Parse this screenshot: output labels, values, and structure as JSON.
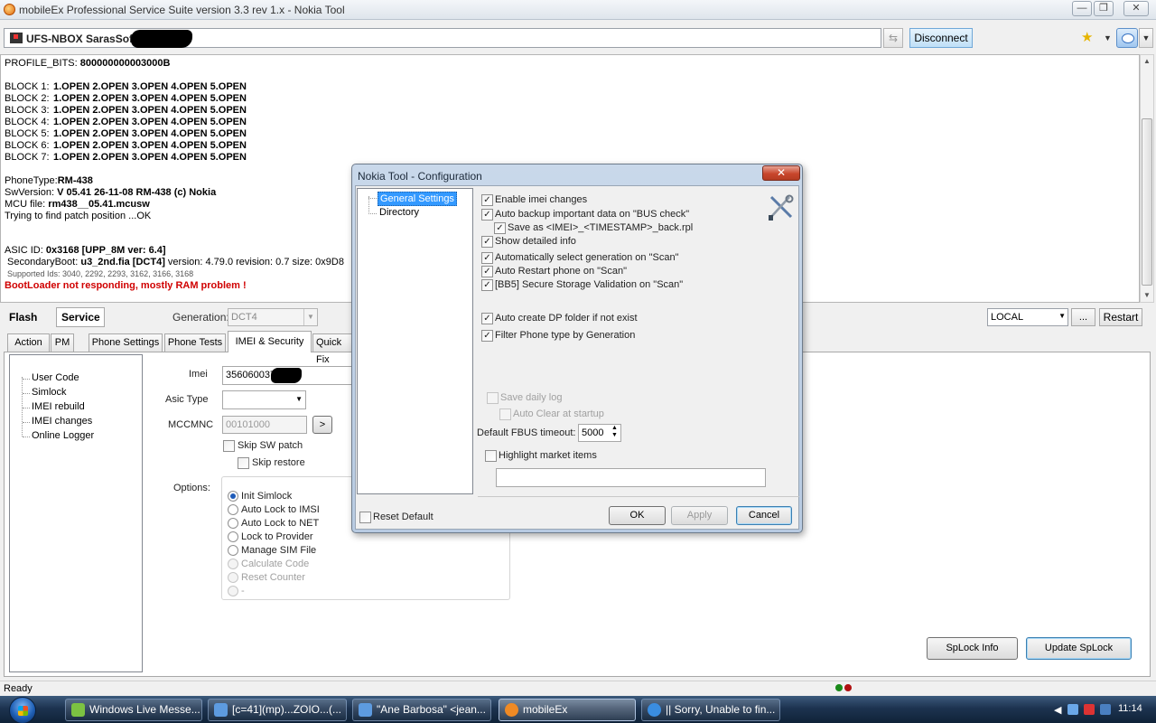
{
  "window": {
    "title": "mobileEx Professional Service Suite version 3.3 rev 1.x - Nokia Tool",
    "minimize": "—",
    "maximize": "❐",
    "close": "✕"
  },
  "toolbar": {
    "device": "UFS-NBOX SarasSoft -",
    "refresh": "⇆",
    "disconnect": "Disconnect"
  },
  "log": {
    "profile_label": "PROFILE_BITS:",
    "profile_value": "800000000003000B",
    "blocks": [
      {
        "label": "BLOCK 1:",
        "value": "1.OPEN 2.OPEN 3.OPEN 4.OPEN 5.OPEN"
      },
      {
        "label": "BLOCK 2:",
        "value": "1.OPEN 2.OPEN 3.OPEN 4.OPEN 5.OPEN"
      },
      {
        "label": "BLOCK 3:",
        "value": "1.OPEN 2.OPEN 3.OPEN 4.OPEN 5.OPEN"
      },
      {
        "label": "BLOCK 4:",
        "value": "1.OPEN 2.OPEN 3.OPEN 4.OPEN 5.OPEN"
      },
      {
        "label": "BLOCK 5:",
        "value": "1.OPEN 2.OPEN 3.OPEN 4.OPEN 5.OPEN"
      },
      {
        "label": "BLOCK 6:",
        "value": "1.OPEN 2.OPEN 3.OPEN 4.OPEN 5.OPEN"
      },
      {
        "label": "BLOCK 7:",
        "value": "1.OPEN 2.OPEN 3.OPEN 4.OPEN 5.OPEN"
      }
    ],
    "phone_type_label": "PhoneType:",
    "phone_type_value": "RM-438",
    "sw_label": "SwVersion:",
    "sw_value": "V 05.41 26-11-08 RM-438 (c) Nokia",
    "mcu_label": "MCU file:",
    "mcu_value": "rm438__05.41.mcusw",
    "patch_line": "Trying to find patch position ...OK",
    "asic_label": "ASIC ID:",
    "asic_value": "0x3168 [UPP_8M ver: 6.4]",
    "secboot_label": "SecondaryBoot:",
    "secboot_value": "u3_2nd.fia [DCT4]",
    "secboot_rest": "version: 4.79.0 revision: 0.7 size: 0x9D8",
    "supported_ids": "Supported Ids: 3040, 2292, 2293, 3162, 3166, 3168",
    "error": "BootLoader not responding, mostly RAM problem !"
  },
  "modes": {
    "flash": "Flash",
    "service": "Service"
  },
  "generation": {
    "label": "Generation:",
    "value": "DCT4"
  },
  "connection": {
    "value": "LOCAL",
    "more": "...",
    "restart": "Restart"
  },
  "tabs": [
    "Action",
    "PM",
    "Phone Settings",
    "Phone Tests",
    "IMEI & Security",
    "Quick Fix"
  ],
  "security_tree": [
    "User Code",
    "Simlock",
    "IMEI rebuild",
    "IMEI changes",
    "Online Logger"
  ],
  "form": {
    "imei_label": "Imei",
    "imei_value": "356060037",
    "asic_type_label": "Asic Type",
    "mccmnc_label": "MCCMNC",
    "mccmnc_placeholder": "00101000",
    "go": ">",
    "skip_sw_patch": "Skip SW patch",
    "skip_restore": "Skip restore",
    "options_label": "Options:",
    "options": [
      "Init Simlock",
      "Auto Lock to IMSI",
      "Auto Lock to NET",
      "Lock to Provider",
      "Manage SIM File",
      "Calculate Code",
      "Reset Counter",
      "-"
    ]
  },
  "buttons": {
    "splock_info": "SpLock Info",
    "update_splock": "Update SpLock"
  },
  "status": {
    "text": "Ready"
  },
  "dialog": {
    "title": "Nokia Tool - Configuration",
    "close": "✕",
    "tree": [
      "General Settings",
      "Directory"
    ],
    "checks": [
      {
        "label": "Enable imei changes",
        "checked": true
      },
      {
        "label": "Auto backup important data on \"BUS check\"",
        "checked": true
      },
      {
        "label": "Save as <IMEI>_<TIMESTAMP>_back.rpl",
        "checked": true
      },
      {
        "label": "Show detailed info",
        "checked": true
      },
      {
        "label": "Automatically select generation on \"Scan\"",
        "checked": true
      },
      {
        "label": "Auto Restart phone on \"Scan\"",
        "checked": true
      },
      {
        "label": "[BB5] Secure Storage Validation on \"Scan\"",
        "checked": true
      },
      {
        "label": "Auto create DP folder if not exist",
        "checked": true
      },
      {
        "label": "Filter Phone type by Generation",
        "checked": true
      }
    ],
    "save_daily_log": "Save daily log",
    "auto_clear": "Auto Clear at startup",
    "fbus_label": "Default FBUS timeout:",
    "fbus_value": "5000",
    "highlight": "Highlight market items",
    "reset_default": "Reset Default",
    "ok": "OK",
    "apply": "Apply",
    "cancel": "Cancel"
  },
  "taskbar": {
    "items": [
      "Windows Live Messe...",
      "[c=41](mp)...ZOIO...(...",
      "\"Ane Barbosa\" <jean...",
      "mobileEx",
      "|| Sorry, Unable to fin..."
    ],
    "time": "11:14"
  },
  "colors": {
    "accent": "#3399ff",
    "error": "#d00000",
    "taskbar": "#1d3350"
  }
}
